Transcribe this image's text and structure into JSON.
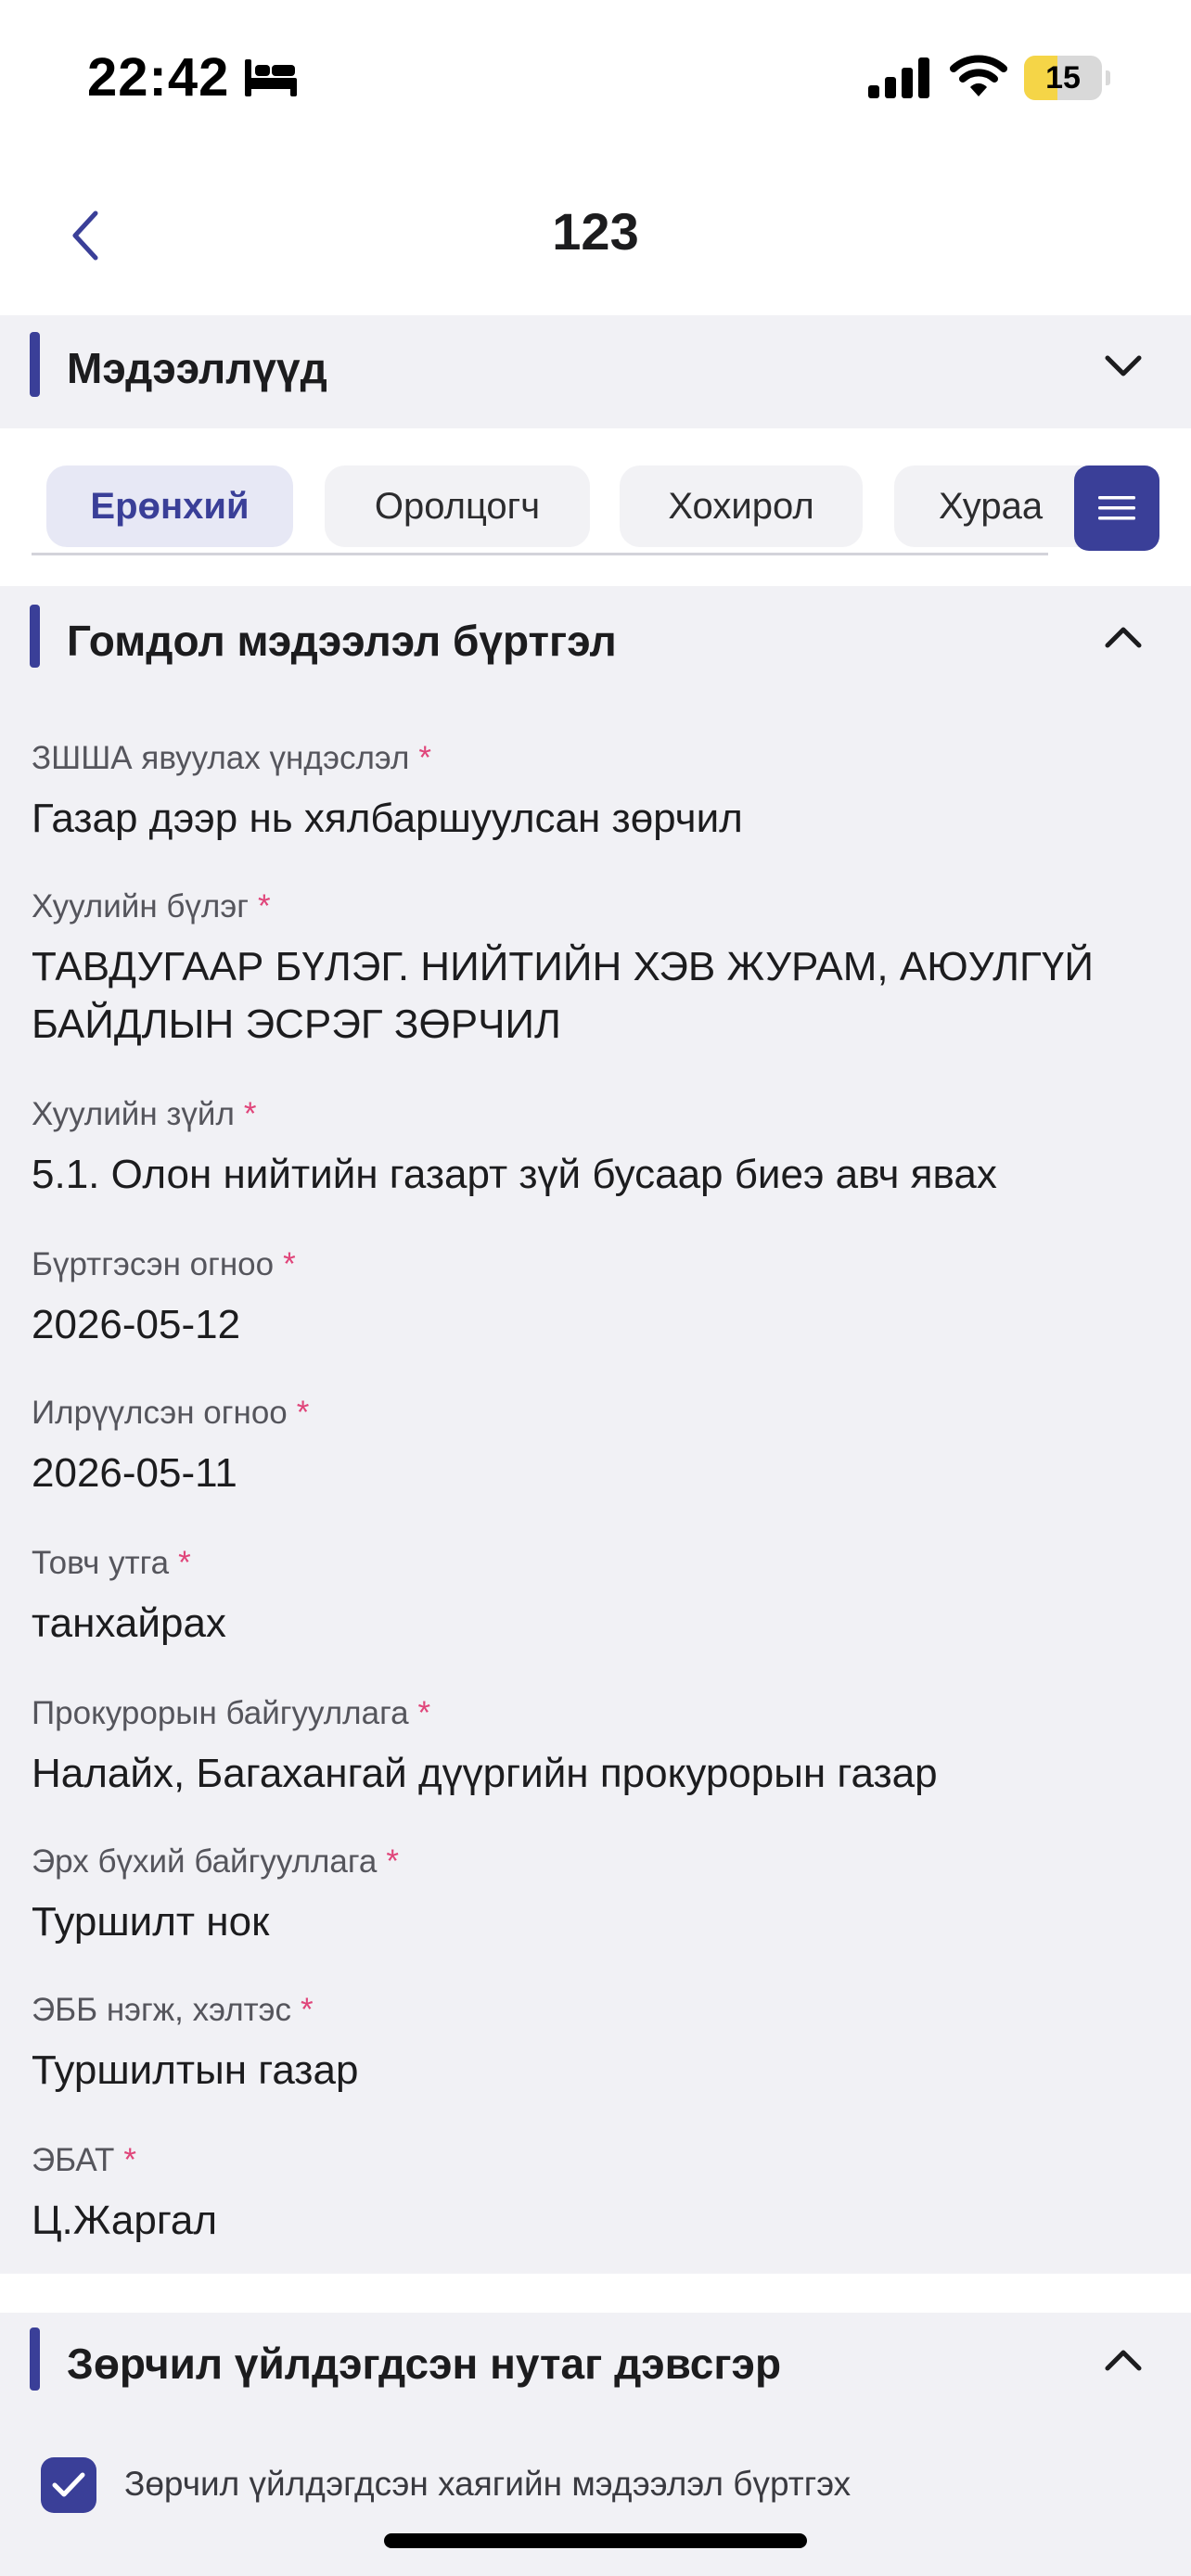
{
  "status_bar": {
    "time": "22:42",
    "battery": "15"
  },
  "header": {
    "title": "123"
  },
  "sections": {
    "info": {
      "title": "Мэдээллүүд"
    },
    "complaint": {
      "title": "Гомдол мэдээлэл бүртгэл"
    },
    "location": {
      "title": "Зөрчил үйлдэгдсэн нутаг дэвсгэр",
      "checkbox_label": "Зөрчил үйлдэгдсэн хаягийн мэдээлэл бүртгэх",
      "checkbox_checked": true
    }
  },
  "tabs": [
    {
      "label": "Ерөнхий",
      "active": true
    },
    {
      "label": "Оролцогч",
      "active": false
    },
    {
      "label": "Хохирол",
      "active": false
    },
    {
      "label": "Хураа",
      "active": false
    }
  ],
  "required_mark": "*",
  "fields": [
    {
      "label": "ЗШША явуулах үндэслэл",
      "value": "Газар дээр нь хялбаршуулсан зөрчил"
    },
    {
      "label": "Хуулийн бүлэг",
      "value": "ТАВДУГААР БҮЛЭГ. НИЙТИЙН ХЭВ ЖУРАМ, АЮУЛГҮЙ БАЙДЛЫН ЭСРЭГ ЗӨРЧИЛ"
    },
    {
      "label": "Хуулийн зүйл",
      "value": "5.1. Олон нийтийн газарт зүй бусаар биеэ авч явах"
    },
    {
      "label": "Бүртгэсэн огноо",
      "value": "2026-05-12"
    },
    {
      "label": "Илрүүлсэн огноо",
      "value": "2026-05-11"
    },
    {
      "label": "Товч утга",
      "value": "танхайрах"
    },
    {
      "label": "Прокурорын байгууллага",
      "value": "Налайх, Багахангай дүүргийн прокурорын газар"
    },
    {
      "label": "Эрх бүхий байгууллага",
      "value": "Туршилт нок"
    },
    {
      "label": "ЭББ нэгж, хэлтэс",
      "value": "Туршилтын газар"
    },
    {
      "label": "ЭБАТ",
      "value": "Ц.Жаргал"
    }
  ],
  "colors": {
    "accent": "#3a3f98",
    "required": "#e0457a",
    "section_bg": "#f1f1f5"
  }
}
